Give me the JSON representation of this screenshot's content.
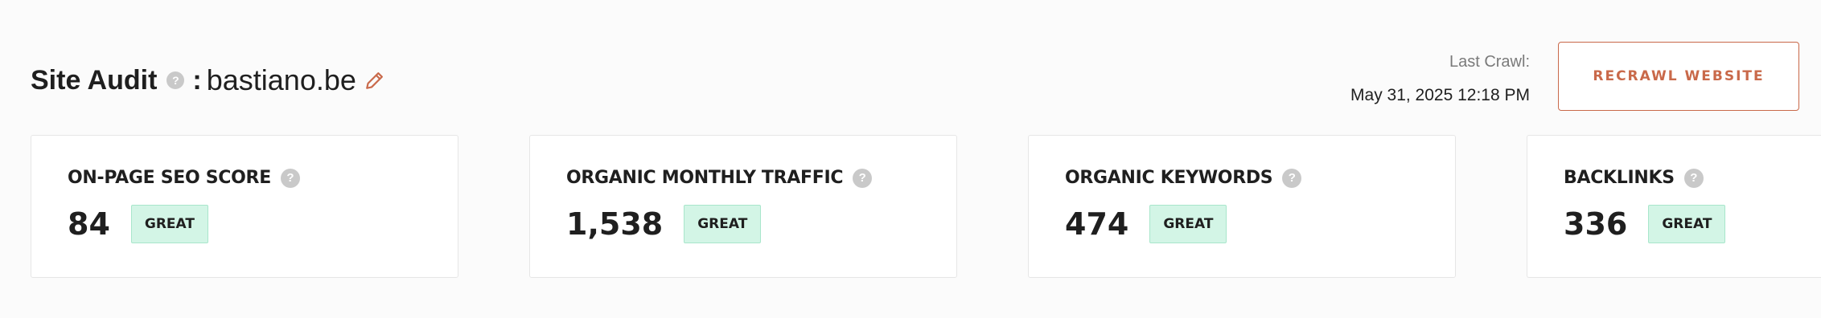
{
  "header": {
    "title": "Site Audit",
    "help": "?",
    "colon": ":",
    "domain": "bastiano.be",
    "edit_icon": "pencil-icon"
  },
  "crawl": {
    "label": "Last Crawl:",
    "value": "May 31, 2025 12:18 PM"
  },
  "recrawl_button": {
    "label": "RECRAWL WEBSITE"
  },
  "colors": {
    "accent": "#c9694a",
    "badge_bg": "#d3f5e6",
    "badge_border": "#a8e6cb",
    "help_icon": "#c9c9c9"
  },
  "cards": [
    {
      "label": "ON-PAGE SEO SCORE",
      "value": "84",
      "badge": "GREAT",
      "help": "?"
    },
    {
      "label": "ORGANIC MONTHLY TRAFFIC",
      "value": "1,538",
      "badge": "GREAT",
      "help": "?"
    },
    {
      "label": "ORGANIC KEYWORDS",
      "value": "474",
      "badge": "GREAT",
      "help": "?"
    },
    {
      "label": "BACKLINKS",
      "value": "336",
      "badge": "GREAT",
      "help": "?"
    }
  ]
}
